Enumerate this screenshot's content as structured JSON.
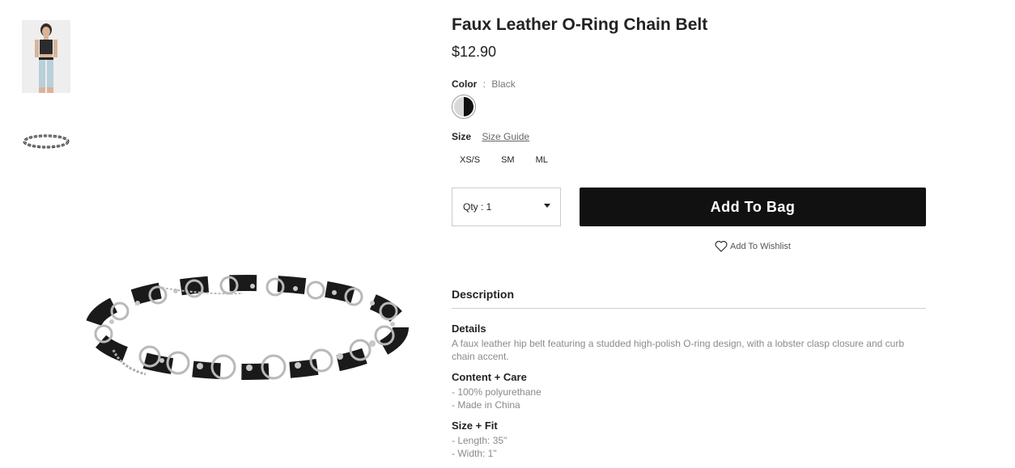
{
  "product": {
    "title": "Faux Leather O-Ring Chain Belt",
    "price": "$12.90"
  },
  "color": {
    "label": "Color",
    "separator": ":",
    "value": "Black"
  },
  "size": {
    "label": "Size",
    "guide_link": "Size Guide",
    "options": [
      "XS/S",
      "SM",
      "ML"
    ]
  },
  "qty": {
    "label": "Qty : 1"
  },
  "actions": {
    "add_to_bag": "Add To Bag",
    "wishlist": "Add To Wishlist"
  },
  "description": {
    "heading": "Description",
    "details_title": "Details",
    "details_text": "A faux leather hip belt featuring a studded high-polish O-ring design, with a lobster clasp closure and curb chain accent.",
    "content_title": "Content + Care",
    "content_items": [
      "- 100% polyurethane",
      "- Made in China"
    ],
    "fit_title": "Size + Fit",
    "fit_items": [
      "- Length: 35\"",
      "- Width: 1\""
    ]
  },
  "icons": {
    "heart": "heart-icon",
    "caret": "chevron-down-icon"
  },
  "colors": {
    "button_bg": "#111111",
    "swatch_dark": "#111111",
    "swatch_light": "#d9d9d9"
  }
}
